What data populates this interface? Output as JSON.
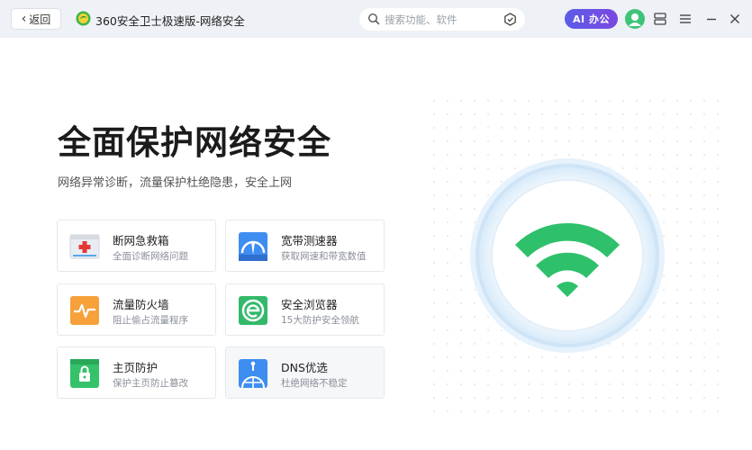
{
  "titlebar": {
    "back_label": "返回",
    "app_title": "360安全卫士极速版-网络安全",
    "search_placeholder": "搜索功能、软件",
    "ai_label": "AI 办公"
  },
  "hero": {
    "title": "全面保护网络安全",
    "subtitle": "网络异常诊断，流量保护杜绝隐患，安全上网"
  },
  "tools": [
    {
      "title": "断网急救箱",
      "desc": "全面诊断网络问题",
      "icon": "first-aid-kit-icon"
    },
    {
      "title": "宽带测速器",
      "desc": "获取网速和带宽数值",
      "icon": "speedometer-icon"
    },
    {
      "title": "流量防火墙",
      "desc": "阻止偷占流量程序",
      "icon": "firewall-icon"
    },
    {
      "title": "安全浏览器",
      "desc": "15大防护安全领航",
      "icon": "browser-icon"
    },
    {
      "title": "主页防护",
      "desc": "保护主页防止篡改",
      "icon": "homepage-lock-icon"
    },
    {
      "title": "DNS优选",
      "desc": "杜绝网络不稳定",
      "icon": "dns-globe-icon"
    }
  ],
  "colors": {
    "accent_green": "#2fc06b",
    "ai_gradient_start": "#5b5ce8",
    "ai_gradient_end": "#7b48e0",
    "titlebar_bg": "#eef1f6"
  }
}
